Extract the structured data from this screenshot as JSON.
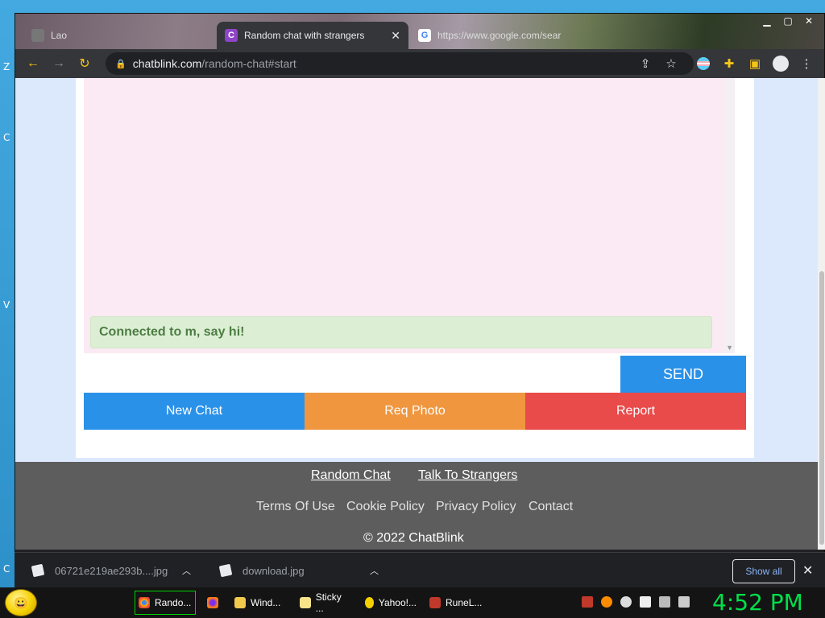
{
  "desktop": {
    "letters": [
      "Z",
      "C",
      "V",
      "C"
    ]
  },
  "browser": {
    "tabs": [
      {
        "title": "Lao",
        "active": false
      },
      {
        "title": "Random chat with strangers",
        "active": true,
        "favicon": "C"
      },
      {
        "title": "https://www.google.com/sear",
        "active": false,
        "favicon": "G"
      }
    ],
    "close_glyph": "✕",
    "url_domain": "chatblink.com",
    "url_path": "/random-chat#start"
  },
  "page": {
    "status_message": "Connected to m, say hi!",
    "input_placeholder": "",
    "send_label": "SEND",
    "buttons": {
      "new_chat": "New Chat",
      "req_photo": "Req Photo",
      "report": "Report"
    },
    "footer": {
      "links_primary": [
        "Random Chat",
        "Talk To Strangers"
      ],
      "links_secondary": [
        "Terms Of Use",
        "Cookie Policy",
        "Privacy Policy",
        "Contact"
      ],
      "copyright": "© 2022 ChatBlink"
    }
  },
  "downloads": {
    "items": [
      "06721e219ae293b....jpg",
      "download.jpg"
    ],
    "show_all": "Show all",
    "close": "✕"
  },
  "taskbar": {
    "tasks": [
      "Rando...",
      "Wind...",
      "Sticky ...",
      "Yahoo!...",
      "RuneL..."
    ],
    "clock": "4:52 PM"
  },
  "colors": {
    "send": "#2a91e8",
    "new_chat": "#2a91e8",
    "req_photo": "#ef963f",
    "report": "#e94a4a",
    "status_bg": "#dcefd5",
    "footer_bg": "#5d5d5d",
    "clock": "#00e04a"
  }
}
